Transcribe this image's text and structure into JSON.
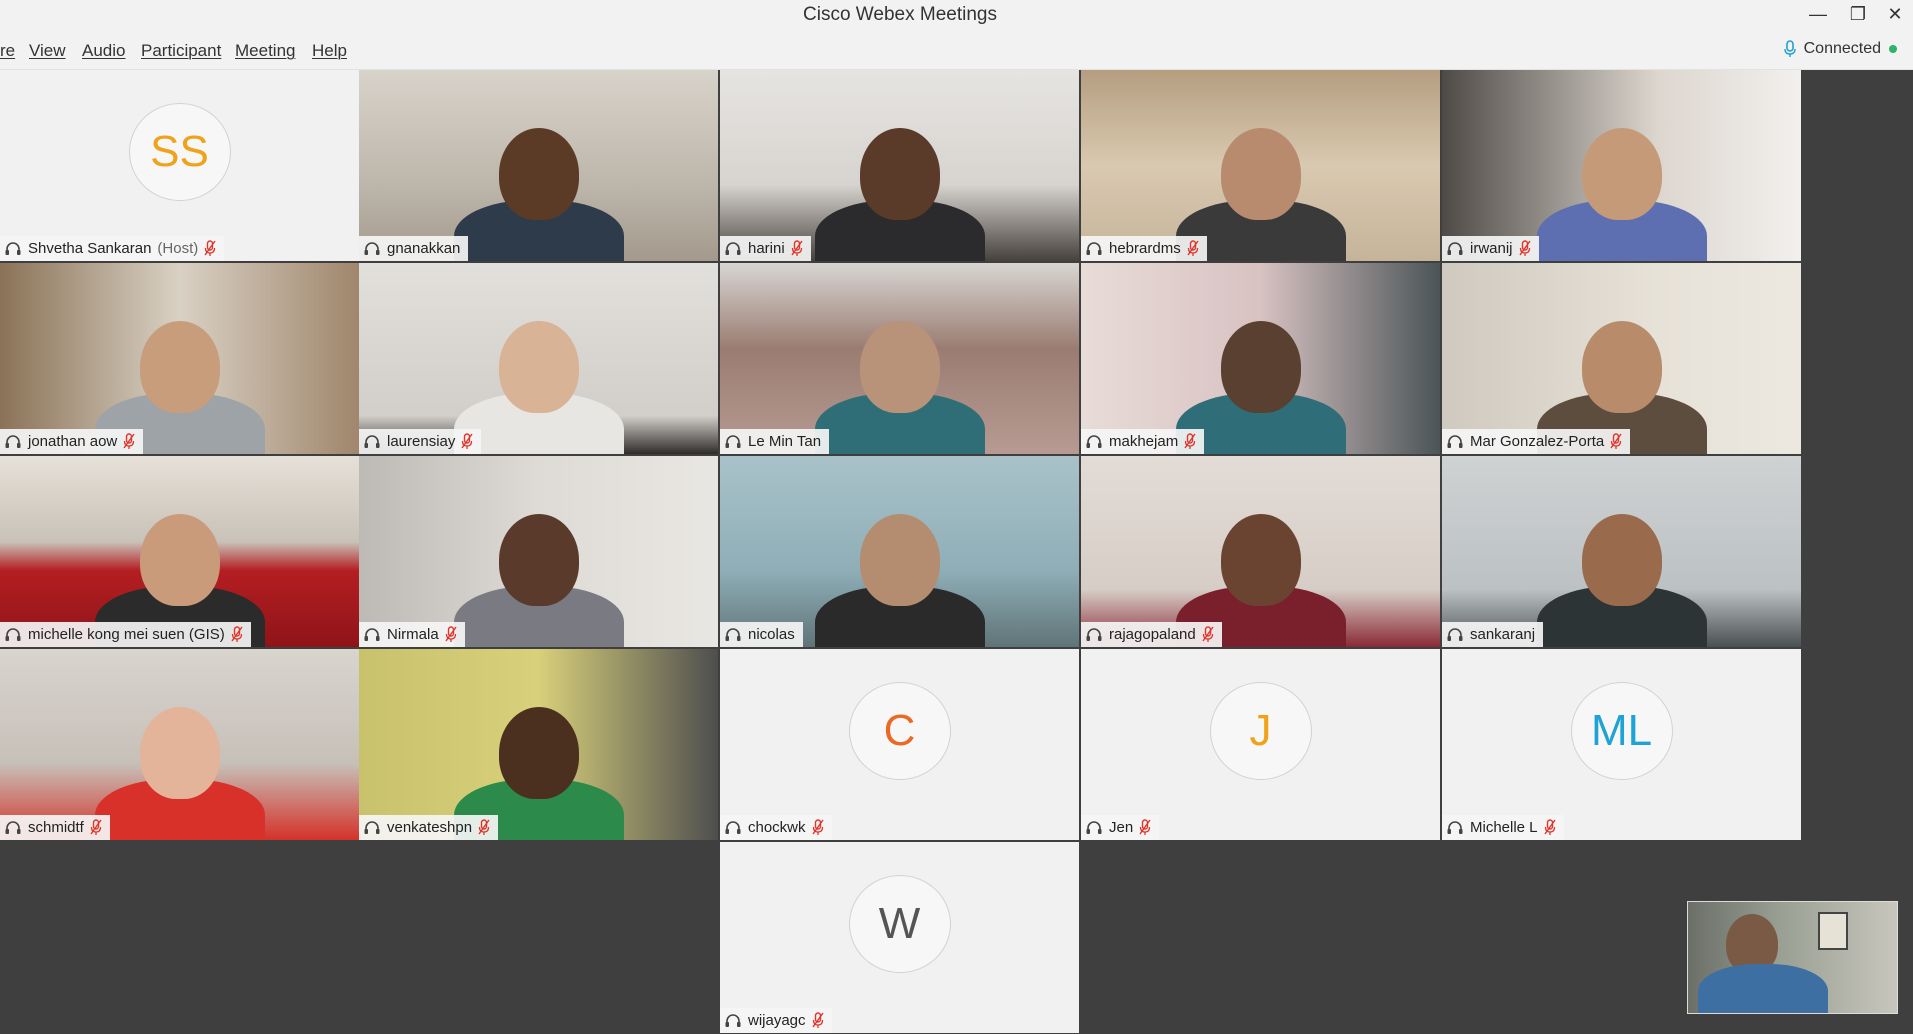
{
  "window": {
    "title": "Cisco Webex Meetings",
    "minimize_symbol": "—",
    "restore_symbol": "❐",
    "close_symbol": "✕"
  },
  "menu": {
    "items": [
      "re",
      "View",
      "Audio",
      "Participant",
      "Meeting",
      "Help"
    ]
  },
  "status": {
    "text": "Connected",
    "mic_icon": "microphone-icon",
    "dot_color": "#2fb36a"
  },
  "participants": [
    {
      "name": "Shvetha Sankaran",
      "suffix": "(Host)",
      "initials": "SS",
      "initials_color": "#f0a21a",
      "muted": true,
      "type": "avatar"
    },
    {
      "name": "gnanakkan",
      "muted": false,
      "type": "video"
    },
    {
      "name": "harini",
      "muted": true,
      "type": "video"
    },
    {
      "name": "hebrardms",
      "muted": true,
      "type": "video"
    },
    {
      "name": "irwanij",
      "muted": true,
      "type": "video"
    },
    {
      "name": "jonathan aow",
      "muted": true,
      "type": "video"
    },
    {
      "name": "laurensiay",
      "muted": true,
      "type": "video"
    },
    {
      "name": "Le Min Tan",
      "muted": false,
      "type": "video"
    },
    {
      "name": "makhejam",
      "muted": true,
      "type": "video"
    },
    {
      "name": "Mar Gonzalez-Porta",
      "muted": true,
      "type": "video"
    },
    {
      "name": "michelle kong mei suen (GIS)",
      "muted": true,
      "type": "video"
    },
    {
      "name": "Nirmala",
      "muted": true,
      "type": "video"
    },
    {
      "name": "nicolas",
      "muted": false,
      "type": "video",
      "active_speaker": true
    },
    {
      "name": "rajagopaland",
      "muted": true,
      "type": "video"
    },
    {
      "name": "sankaranj",
      "muted": false,
      "type": "video"
    },
    {
      "name": "schmidtf",
      "muted": true,
      "type": "video"
    },
    {
      "name": "venkateshpn",
      "muted": true,
      "type": "video"
    },
    {
      "name": "chockwk",
      "initials": "C",
      "initials_color": "#ea6a25",
      "muted": true,
      "type": "avatar"
    },
    {
      "name": "Jen",
      "initials": "J",
      "initials_color": "#f0a21a",
      "muted": true,
      "type": "avatar"
    },
    {
      "name": "Michelle L",
      "initials": "ML",
      "initials_color": "#1fa3d6",
      "muted": true,
      "type": "avatar"
    },
    {
      "name": "wijayagc",
      "initials": "W",
      "initials_color": "#555555",
      "muted": true,
      "type": "avatar"
    }
  ],
  "colors": {
    "active_speaker_border": "#21a0d2",
    "mute_icon": "#e0352b",
    "stage_background": "#3f3f3f"
  }
}
